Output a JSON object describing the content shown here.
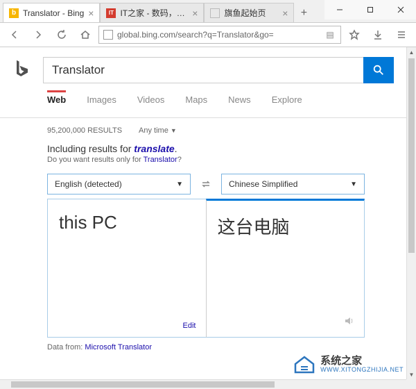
{
  "window": {
    "min": "—",
    "max": "☐",
    "close": "✕"
  },
  "tabs": [
    {
      "title": "Translator - Bing",
      "favicon_bg": "#f7b600",
      "favicon_text": "b",
      "favicon_color": "#fff"
    },
    {
      "title": "IT之家 - 数码，科技",
      "favicon_bg": "#d43c2f",
      "favicon_text": "IT",
      "favicon_color": "#fff"
    },
    {
      "title": "旗鱼起始页",
      "favicon_bg": "transparent",
      "favicon_text": "",
      "favicon_color": "#888"
    }
  ],
  "tab_new": "+",
  "address": "global.bing.com/search?q=Translator&go=",
  "search_query": "Translator",
  "nav": [
    "Web",
    "Images",
    "Videos",
    "Maps",
    "News",
    "Explore"
  ],
  "results_count": "95,200,000 RESULTS",
  "time_filter": "Any time",
  "dym_prefix": "Including results for ",
  "dym_word": "translate",
  "dym_suffix": ".",
  "dym_q_prefix": "Do you want results only for ",
  "dym_q_link": "Translator",
  "dym_q_suffix": "?",
  "lang_from": "English (detected)",
  "lang_to": "Chinese Simplified",
  "source_text": "this PC",
  "target_text": "这台电脑",
  "edit_label": "Edit",
  "data_from_prefix": "Data from: ",
  "data_from_link": "Microsoft Translator",
  "watermark": {
    "cn": "系统之家",
    "en": "WWW.XITONGZHIJIA.NET"
  }
}
